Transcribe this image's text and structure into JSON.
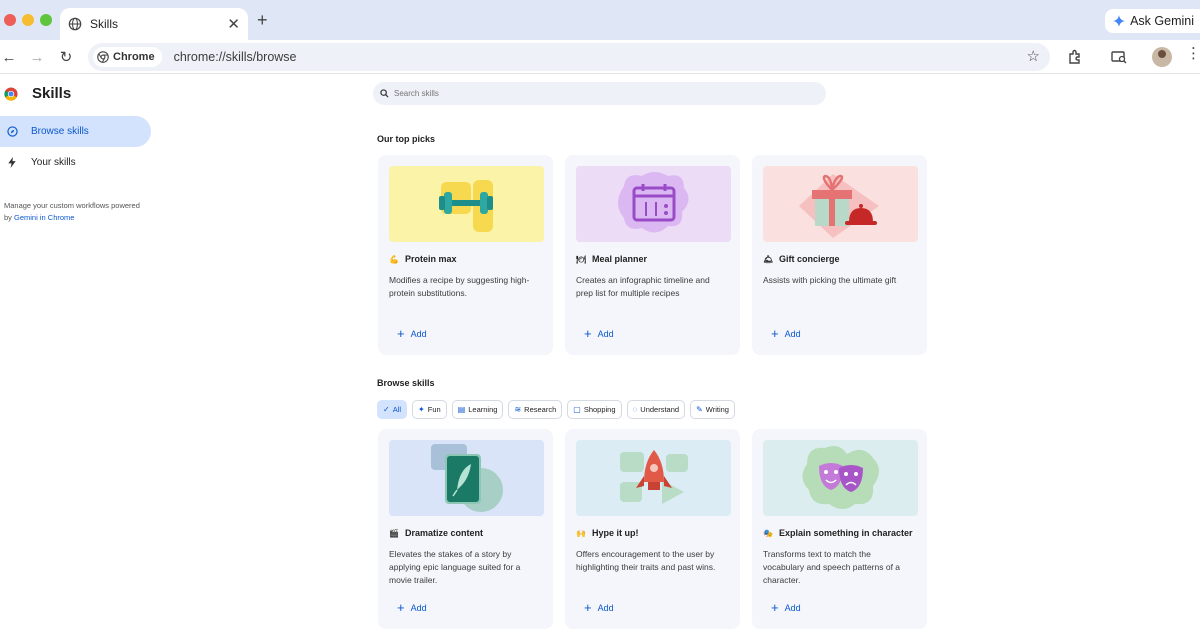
{
  "window": {
    "tab_title": "Skills",
    "ask_gemini": "Ask Gemini"
  },
  "toolbar": {
    "chip_label": "Chrome",
    "url": "chrome://skills/browse"
  },
  "sidebar": {
    "title": "Skills",
    "items": [
      {
        "label": "Browse skills",
        "icon": "compass-icon",
        "active": true
      },
      {
        "label": "Your skills",
        "icon": "bolt-icon",
        "active": false
      }
    ],
    "note_text": "Manage your custom workflows powered by",
    "note_link": "Gemini in Chrome"
  },
  "main": {
    "search_placeholder": "Search skills",
    "top_picks_title": "Our top picks",
    "browse_title": "Browse skills",
    "add_label": "Add",
    "top_picks": [
      {
        "emoji": "💪",
        "title": "Protein max",
        "desc": "Modifies a recipe by suggesting high-protein substitutions.",
        "color": "#fbf3a8"
      },
      {
        "emoji": "🍽",
        "title": "Meal planner",
        "desc": "Creates an infographic timeline and prep list for multiple recipes",
        "color": "#ecdcf6"
      },
      {
        "emoji": "🛎",
        "title": "Gift concierge",
        "desc": "Assists with picking the ultimate gift",
        "color": "#fbe0e0"
      }
    ],
    "filters": [
      {
        "label": "All",
        "icon": "check-icon",
        "selected": true
      },
      {
        "label": "Fun",
        "icon": "sparkle-icon",
        "selected": false
      },
      {
        "label": "Learning",
        "icon": "book-icon",
        "selected": false
      },
      {
        "label": "Research",
        "icon": "chart-icon",
        "selected": false
      },
      {
        "label": "Shopping",
        "icon": "bag-icon",
        "selected": false
      },
      {
        "label": "Understand",
        "icon": "bulb-icon",
        "selected": false
      },
      {
        "label": "Writing",
        "icon": "pen-icon",
        "selected": false
      }
    ],
    "browse": [
      {
        "emoji": "🎬",
        "title": "Dramatize content",
        "desc": "Elevates the stakes of a story by applying epic language suited for a movie trailer.",
        "color": "#d9e4f8"
      },
      {
        "emoji": "🙌",
        "title": "Hype it up!",
        "desc": "Offers encouragement to the user by highlighting their traits and past wins.",
        "color": "#dcecf5"
      },
      {
        "emoji": "🎭",
        "title": "Explain something in character",
        "desc": "Transforms text to match the vocabulary and speech patterns of a character.",
        "color": "#dcedf0"
      }
    ]
  }
}
